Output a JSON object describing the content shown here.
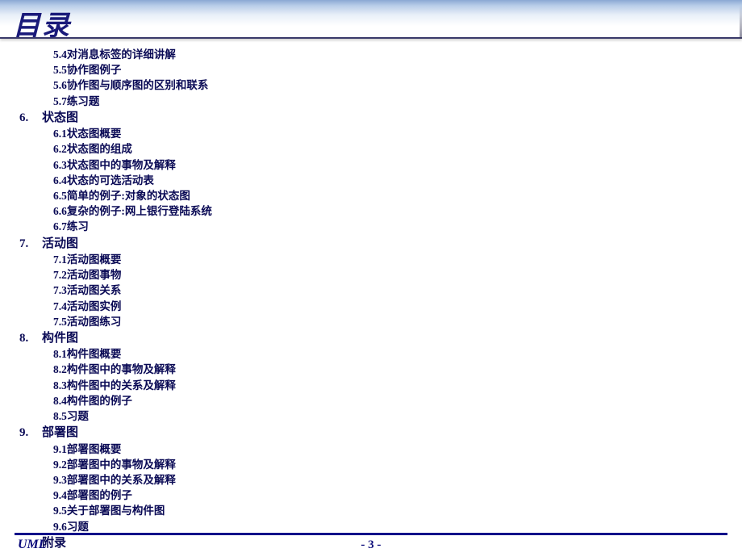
{
  "title": "目录",
  "pre_items": [
    "5.4对消息标签的详细讲解",
    "5.5协作图例子",
    "5.6协作图与顺序图的区别和联系",
    "5.7练习题"
  ],
  "chapters": [
    {
      "num": "6.",
      "title": "状态图",
      "items": [
        "6.1状态图概要",
        "6.2状态图的组成",
        "6.3状态图中的事物及解释",
        "6.4状态的可选活动表",
        "6.5简单的例子:对象的状态图",
        "6.6复杂的例子:网上银行登陆系统",
        "6.7练习"
      ]
    },
    {
      "num": "7.",
      "title": "活动图",
      "items": [
        "7.1活动图概要",
        "7.2活动图事物",
        "7.3活动图关系",
        "7.4活动图实例",
        "7.5活动图练习"
      ]
    },
    {
      "num": "8.",
      "title": "构件图",
      "items": [
        "8.1构件图概要",
        "8.2构件图中的事物及解释",
        "8.3构件图中的关系及解释",
        "8.4构件图的例子",
        "8.5习题"
      ]
    },
    {
      "num": "9.",
      "title": "部署图",
      "items": [
        "9.1部署图概要",
        "9.2部署图中的事物及解释",
        "9.3部署图中的关系及解释",
        "9.4部署图的例子",
        "9.5关于部署图与构件图",
        "9.6习题"
      ]
    }
  ],
  "appendix": "附录",
  "footer": {
    "left": "UML",
    "page": "- 3 -"
  }
}
